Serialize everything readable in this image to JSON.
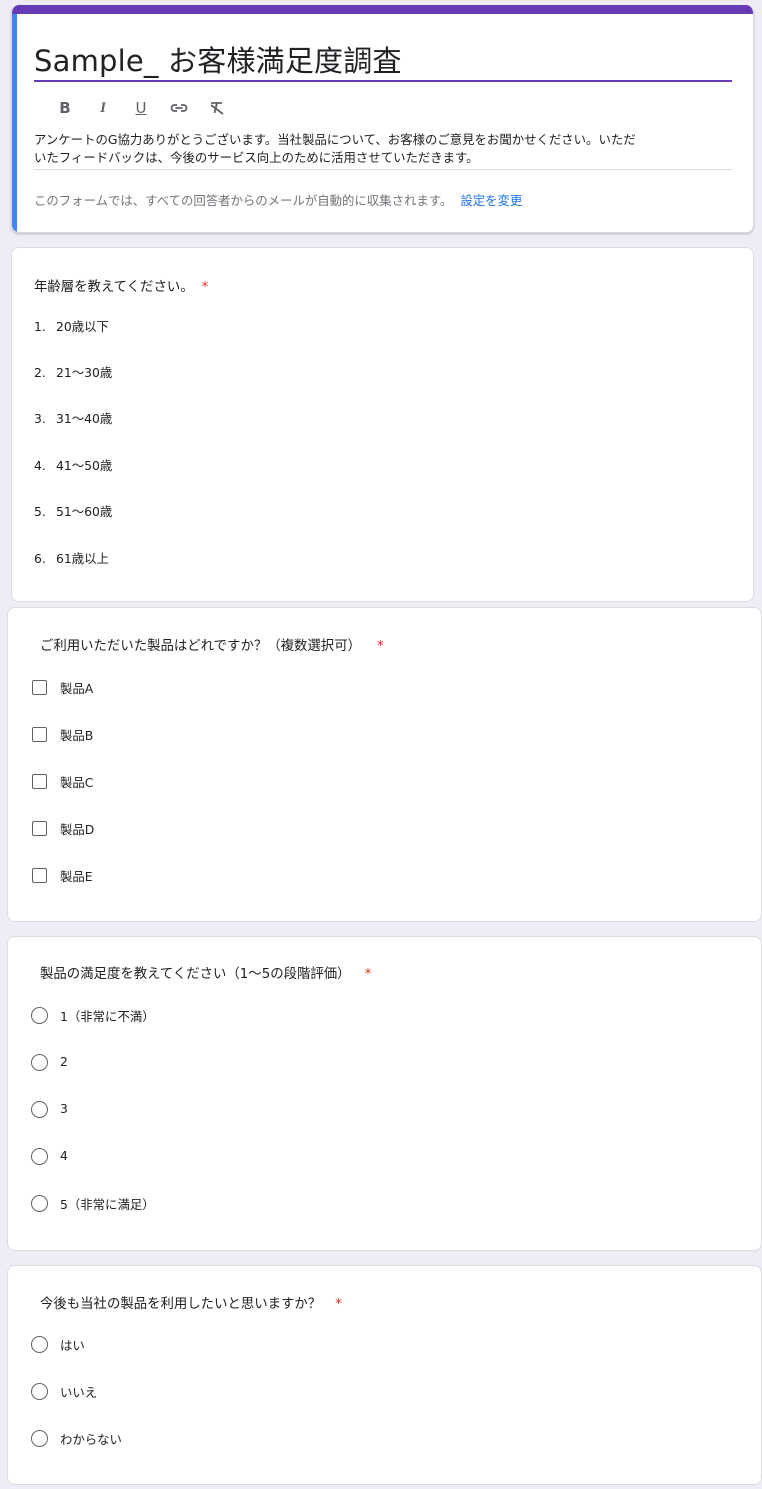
{
  "form": {
    "title": "Sample_ お客様満足度調査",
    "toolbar": [
      "B",
      "I",
      "U",
      "link",
      "clear-format"
    ],
    "description_line1": "アンケートのG協力ありがとうございます。当社製品について、お客様のご意見をお聞かせください。いただ",
    "description_line2": "いたフィードバックは、今後のサービス向上のために活用させていただきます。",
    "note": "このフォームでは、すべての回答者からのメールが自動的に収集されます。",
    "note_link": "設定を変更"
  },
  "questions": [
    {
      "title": "年齢層を教えてください。",
      "required": "*",
      "type": "numbered-list",
      "options": [
        {
          "num": "1.",
          "label": "20歳以下"
        },
        {
          "num": "2.",
          "label": "21～30歳"
        },
        {
          "num": "3.",
          "label": "31～40歳"
        },
        {
          "num": "4.",
          "label": "41～50歳"
        },
        {
          "num": "5.",
          "label": "51～60歳"
        },
        {
          "num": "6.",
          "label": "61歳以上"
        }
      ]
    },
    {
      "title": "ご利用いただいた製品はどれですか？（複数選択可）",
      "required": "*",
      "type": "checkbox",
      "options": [
        "製品A",
        "製品B",
        "製品C",
        "製品D",
        "製品E"
      ]
    },
    {
      "title": "製品の満足度を教えてください（1～5の段階評価）",
      "required": "*",
      "type": "radio",
      "options": [
        "1（非常に不満）",
        "2",
        "3",
        "4",
        "5（非常に満足）"
      ]
    },
    {
      "title": "今後も当社の製品を利用したいと思いますか？",
      "required": "*",
      "type": "radio",
      "options": [
        "はい",
        "いいえ",
        "わからない"
      ]
    }
  ],
  "colors": {
    "accent": "#673ab7",
    "focus": "#4285f4",
    "link": "#1a73e8",
    "required": "#d93025"
  }
}
